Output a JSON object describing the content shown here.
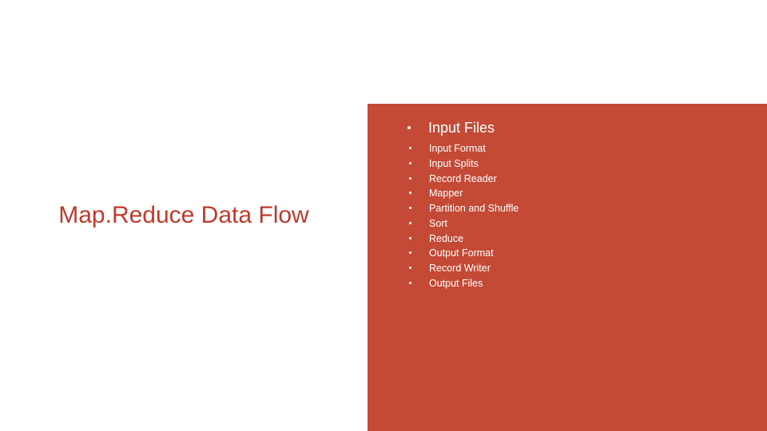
{
  "title": "Map.Reduce Data Flow",
  "main_bullet": "Input Files",
  "sub_bullets": [
    "Input Format",
    "Input Splits",
    "Record Reader",
    "Mapper",
    "Partition and Shuffle",
    "Sort",
    "Reduce",
    "Output Format",
    "Record Writer",
    "Output Files"
  ]
}
